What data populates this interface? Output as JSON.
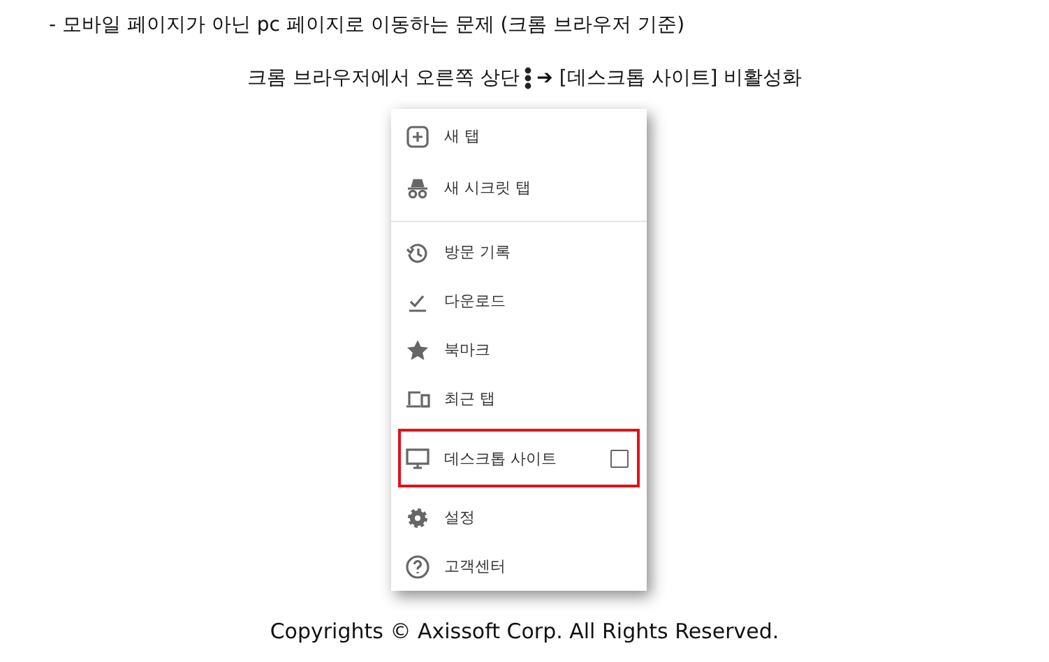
{
  "note": "- 모바일 페이지가 아닌 pc 페이지로 이동하는 문제 (크롬 브라우저 기준)",
  "instruction": {
    "before": "크롬 브라우저에서 오른쪽 상단",
    "after": "**➔** [데스크톱 사이트] 비활성화"
  },
  "menu": {
    "items": [
      {
        "kind": "newtab",
        "label": "새 탭",
        "divider_after": false,
        "highlighted": false
      },
      {
        "kind": "incognito",
        "label": "새 시크릿 탭",
        "divider_after": true,
        "highlighted": false
      },
      {
        "kind": "history",
        "label": "방문 기록",
        "divider_after": false,
        "highlighted": false
      },
      {
        "kind": "download",
        "label": "다운로드",
        "divider_after": false,
        "highlighted": false
      },
      {
        "kind": "bookmark",
        "label": "북마크",
        "divider_after": false,
        "highlighted": false
      },
      {
        "kind": "recent",
        "label": "최근 탭",
        "divider_after": false,
        "highlighted": false
      },
      {
        "kind": "desktop",
        "label": "데스크톱 사이트",
        "checked": false,
        "divider_after": false,
        "highlighted": true
      },
      {
        "kind": "settings",
        "label": "설정",
        "divider_after": false,
        "highlighted": false
      },
      {
        "kind": "help",
        "label": "고객센터",
        "divider_after": false,
        "highlighted": false
      }
    ]
  },
  "footer": "Copyrights © Axissoft Corp. All Rights Reserved."
}
